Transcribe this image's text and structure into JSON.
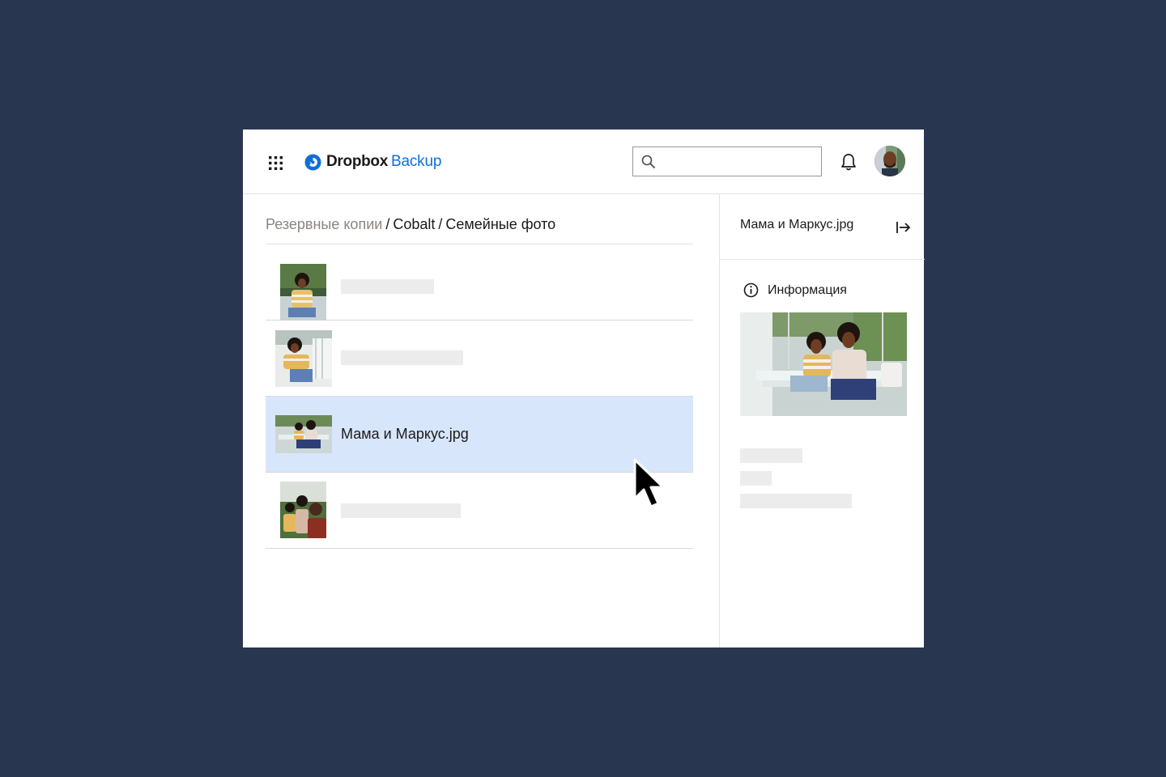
{
  "app": {
    "brand": "Dropbox",
    "product": "Backup",
    "brand_color": "#0f6fd9"
  },
  "header": {
    "apps_icon": "grid-icon",
    "search_placeholder": "",
    "search_value": "",
    "search_icon": "search-icon",
    "notifications_icon": "bell-icon",
    "avatar_icon": "user-avatar"
  },
  "breadcrumb": {
    "root": "Резервные копии",
    "separator": "/",
    "items": [
      "Cobalt",
      "Семейные фото"
    ]
  },
  "files": [
    {
      "name": "",
      "selected": false
    },
    {
      "name": "",
      "selected": false
    },
    {
      "name": "Мама и Маркус.jpg",
      "selected": true
    },
    {
      "name": "",
      "selected": false
    }
  ],
  "panel": {
    "title": "Мама и Маркус.jpg",
    "close_icon": "collapse-panel-icon",
    "tab_label": "Информация",
    "tab_icon": "info-icon"
  },
  "colors": {
    "background": "#283650",
    "selected_row": "#d7e6fb",
    "skeleton": "#ececec"
  }
}
